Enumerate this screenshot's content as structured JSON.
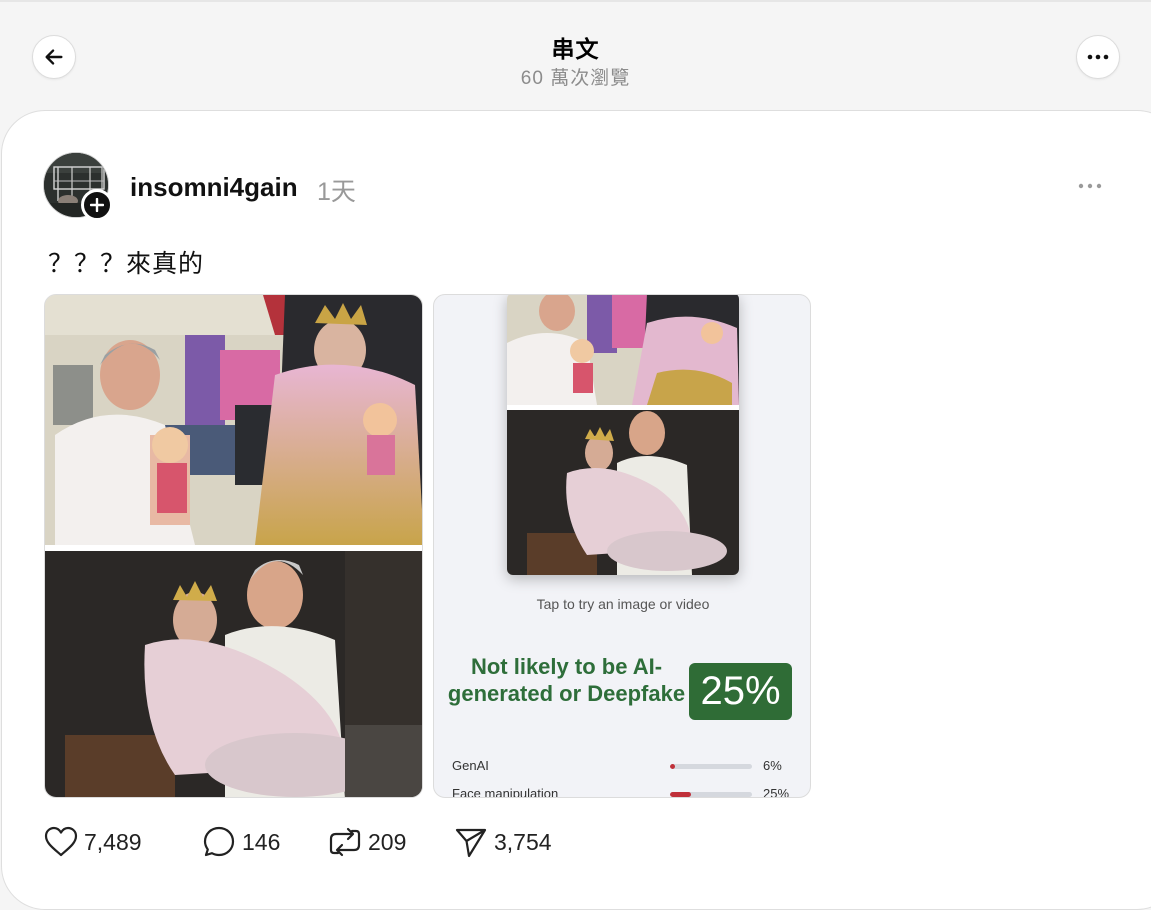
{
  "header": {
    "title": "串文",
    "subtitle": "60 萬次瀏覽",
    "back_icon": "arrow-left-icon",
    "menu_icon": "more-horizontal-icon"
  },
  "post": {
    "username": "insomni4gain",
    "time": "1天",
    "text": "？？？來真的",
    "menu_icon": "more-horizontal-icon"
  },
  "detector": {
    "hint": "Tap to try an image or video",
    "verdict": "Not likely to be AI-generated or Deepfake",
    "score": "25%",
    "rows": [
      {
        "label": "GenAI",
        "percent": "6%",
        "fill": 0.06
      },
      {
        "label": "Face manipulation",
        "percent": "25%",
        "fill": 0.25
      }
    ]
  },
  "actions": {
    "likes": "7,489",
    "comments": "146",
    "reposts": "209",
    "shares": "3,754"
  },
  "colors": {
    "verdict_green": "#2e6e3a",
    "score_box": "#2f6c36",
    "bar_fill": "#c0303a",
    "muted_text": "#8c8c8c"
  }
}
